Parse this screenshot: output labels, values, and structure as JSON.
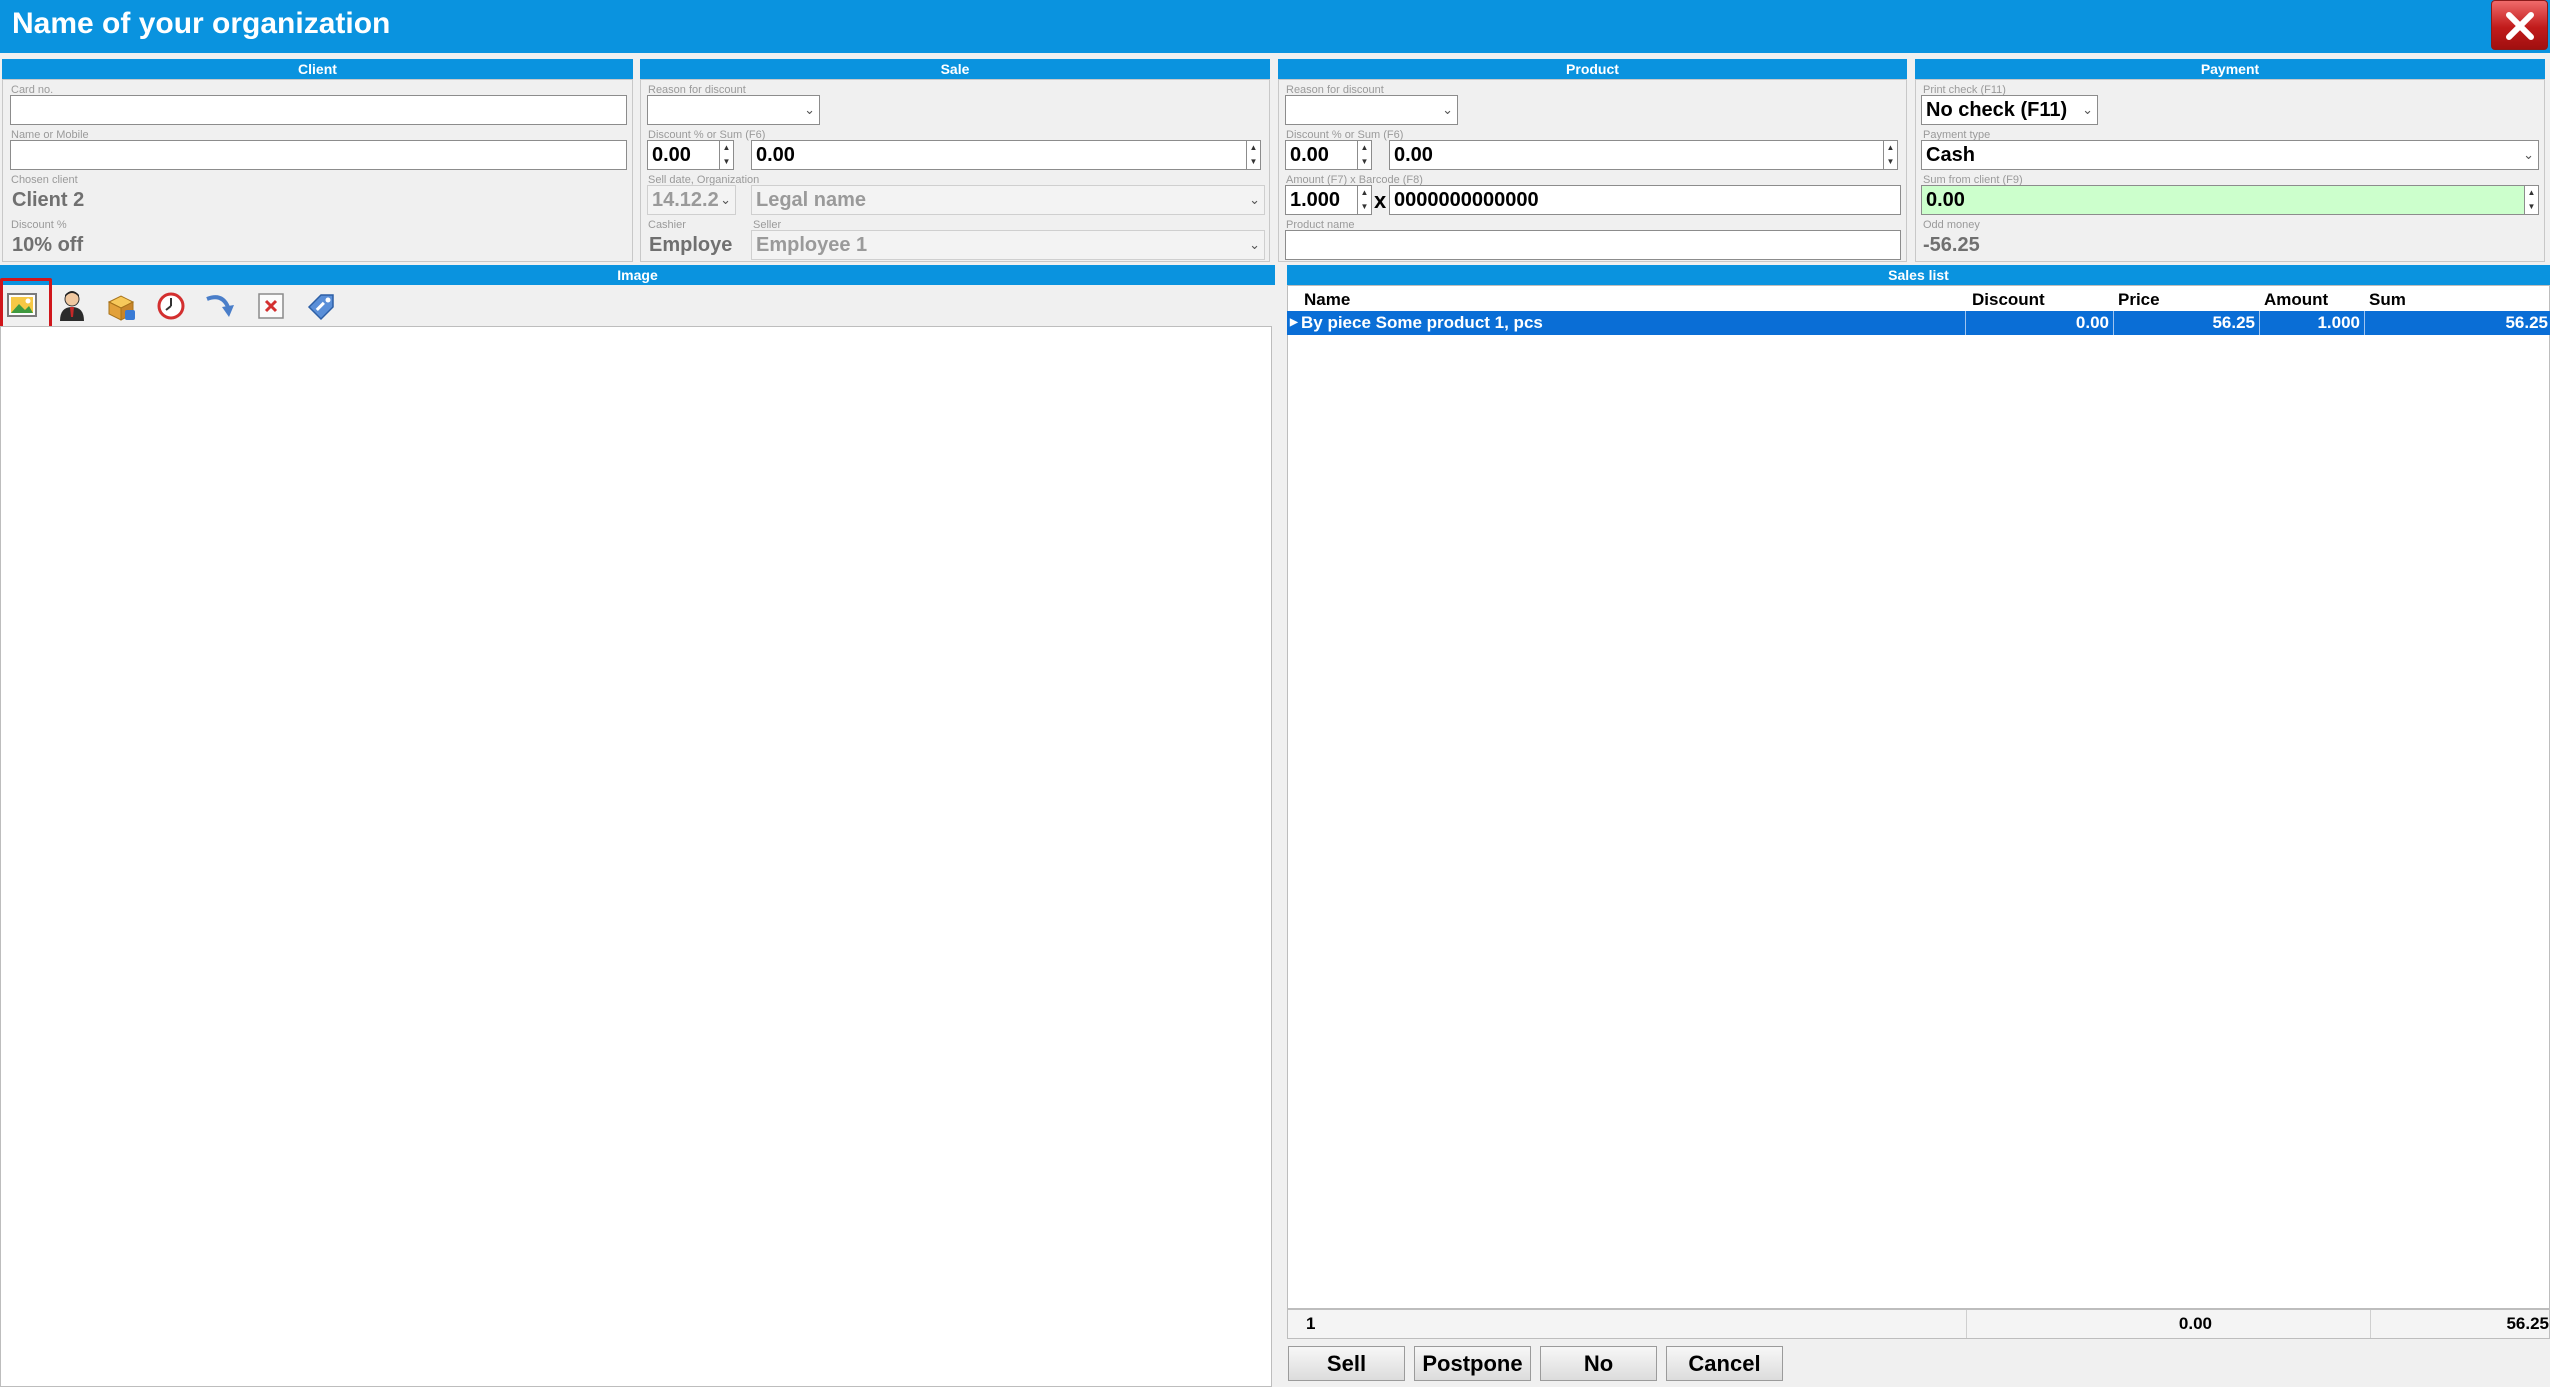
{
  "window": {
    "title": "Name of your organization",
    "close_label": "Close"
  },
  "client": {
    "header": "Client",
    "card_no_label": "Card no.",
    "card_no_value": "",
    "name_label": "Name or Mobile",
    "name_value": "",
    "chosen_label": "Chosen client",
    "chosen_value": "Client 2",
    "discount_label": "Discount %",
    "discount_value": "10% off"
  },
  "sale": {
    "header": "Sale",
    "reason_label": "Reason for discount",
    "reason_value": "",
    "discount_label": "Discount % or Sum (F6)",
    "discount_pct": "0.00",
    "discount_sum": "0.00",
    "date_label": "Sell date, Organization",
    "date_value": "14.12.2",
    "org_value": "Legal name",
    "cashier_label": "Cashier",
    "cashier_value": "Employe",
    "seller_label": "Seller",
    "seller_value": "Employee 1"
  },
  "product": {
    "header": "Product",
    "reason_label": "Reason for discount",
    "reason_value": "",
    "discount_label": "Discount % or Sum (F6)",
    "discount_pct": "0.00",
    "discount_sum": "0.00",
    "amount_label": "Amount (F7) x Barcode (F8)",
    "amount_value": "1.000",
    "x_sign": "x",
    "barcode_value": "0000000000000",
    "name_label": "Product name",
    "name_value": ""
  },
  "payment": {
    "header": "Payment",
    "print_label": "Print check (F11)",
    "print_value": "No check (F11)",
    "type_label": "Payment type",
    "type_value": "Cash",
    "sum_label": "Sum from client (F9)",
    "sum_value": "0.00",
    "odd_label": "Odd money",
    "odd_value": "-56.25"
  },
  "image_panel": {
    "header": "Image"
  },
  "toolbar": {
    "icons": [
      "image-icon",
      "user-icon",
      "products-box-icon",
      "clock-icon",
      "return-arrow-icon",
      "delete-icon",
      "discount-tag-icon"
    ]
  },
  "sales_list": {
    "header": "Sales list",
    "columns": [
      "Name",
      "Discount",
      "Price",
      "Amount",
      "Sum"
    ],
    "rows": [
      {
        "name": "By piece Some product 1, pcs",
        "discount": "0.00",
        "price": "56.25",
        "amount": "1.000",
        "sum": "56.25"
      }
    ],
    "footer": {
      "count": "1",
      "discount_total": "0.00",
      "sum_total": "56.25"
    }
  },
  "buttons": {
    "sell": "Sell",
    "postpone": "Postpone",
    "no": "No",
    "cancel": "Cancel"
  },
  "colors": {
    "accent": "#0a93df",
    "selection": "#0a6ed6",
    "highlight": "#d0161b",
    "sum_field": "#ccffcc"
  }
}
